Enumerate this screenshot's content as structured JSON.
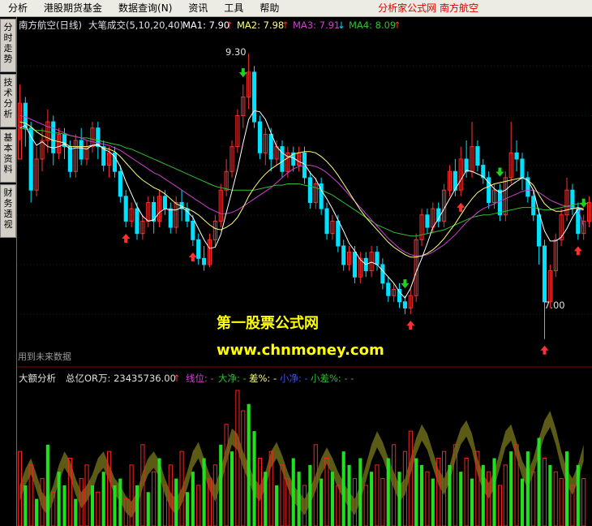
{
  "menubar": {
    "items": [
      "分析",
      "港股期货基金",
      "数据查询(N)",
      "资讯",
      "工具",
      "帮助"
    ],
    "right_text": "分析家公式网  南方航空"
  },
  "sidebar": {
    "tabs": [
      "分时走势",
      "技术分析",
      "基本资料",
      "财务透视"
    ]
  },
  "main_header": {
    "title": "南方航空(日线)",
    "indicator": "大笔成交(5,10,20,40)",
    "ma1": "MA1: 7.90",
    "ma1_arrow": "↑",
    "ma2": "MA2: 7.98",
    "ma2_arrow": "↑",
    "ma3": "MA3: 7.91",
    "ma3_arrow": "↓",
    "ma4": "MA4: 8.09",
    "ma4_arrow": "↑"
  },
  "annotations": {
    "high_label": "9.30",
    "low_label": "7.00",
    "future_data_note": "用到未来数据"
  },
  "watermark": {
    "line1": "第一股票公式网",
    "line2": "www.chnmoney.com"
  },
  "lower_header": {
    "title": "大额分析",
    "total_label": "总亿OR万: 23435736.00",
    "total_arrow": "↑",
    "line_pos": "线位: -",
    "big_net": "大净: -",
    "diff": "差%: -",
    "small_net": "小净: -",
    "small_diff": "小差%: - -"
  },
  "colors": {
    "up": "#ff3030",
    "down": "#00e0ff",
    "ma1": "#ffffff",
    "ma2": "#ffff80",
    "ma3": "#d040d0",
    "ma4": "#30c030",
    "menu_bg": "#ecebe4",
    "signal_up": "#ff3030",
    "signal_down": "#20d020"
  },
  "chart_data": {
    "type": "candlestick",
    "title": "南方航空(日线)",
    "ylim": [
      6.9,
      9.45
    ],
    "candles": [
      [
        8.45,
        8.9,
        8.6,
        9.05
      ],
      [
        8.9,
        8.7,
        8.55,
        8.95
      ],
      [
        8.7,
        8.2,
        8.1,
        8.75
      ],
      [
        8.2,
        8.45,
        8.15,
        8.55
      ],
      [
        8.45,
        8.6,
        8.35,
        8.7
      ],
      [
        8.6,
        8.75,
        8.5,
        8.85
      ],
      [
        8.75,
        8.5,
        8.4,
        8.8
      ],
      [
        8.5,
        8.65,
        8.45,
        8.7
      ],
      [
        8.65,
        8.55,
        8.45,
        8.7
      ],
      [
        8.55,
        8.35,
        8.3,
        8.6
      ],
      [
        8.35,
        8.6,
        8.3,
        8.65
      ],
      [
        8.6,
        8.45,
        8.4,
        8.7
      ],
      [
        8.45,
        8.55,
        8.4,
        8.6
      ],
      [
        8.55,
        8.7,
        8.5,
        8.75
      ],
      [
        8.7,
        8.55,
        8.45,
        8.75
      ],
      [
        8.55,
        8.4,
        8.35,
        8.6
      ],
      [
        8.4,
        8.5,
        8.3,
        8.55
      ],
      [
        8.5,
        8.35,
        8.3,
        8.55
      ],
      [
        8.35,
        8.15,
        8.1,
        8.4
      ],
      [
        8.15,
        7.95,
        7.9,
        8.2
      ],
      [
        7.95,
        8.05,
        7.9,
        8.1
      ],
      [
        8.05,
        7.85,
        7.8,
        8.1
      ],
      [
        7.85,
        7.95,
        7.8,
        8.0
      ],
      [
        7.95,
        8.1,
        7.9,
        8.15
      ],
      [
        8.1,
        7.95,
        7.85,
        8.15
      ],
      [
        7.95,
        8.15,
        7.9,
        8.2
      ],
      [
        8.15,
        8.05,
        8.0,
        8.2
      ],
      [
        8.05,
        7.9,
        7.85,
        8.1
      ],
      [
        7.9,
        8.1,
        7.85,
        8.15
      ],
      [
        8.1,
        8.05,
        7.95,
        8.2
      ],
      [
        8.05,
        7.95,
        7.9,
        8.1
      ],
      [
        7.95,
        7.8,
        7.75,
        8.0
      ],
      [
        7.8,
        7.65,
        7.6,
        7.85
      ],
      [
        7.65,
        7.6,
        7.55,
        7.75
      ],
      [
        7.6,
        7.8,
        7.58,
        7.85
      ],
      [
        7.8,
        7.95,
        7.75,
        8.0
      ],
      [
        7.95,
        8.2,
        7.9,
        8.25
      ],
      [
        8.2,
        8.35,
        8.15,
        8.45
      ],
      [
        8.35,
        8.55,
        8.3,
        8.6
      ],
      [
        8.55,
        8.8,
        8.5,
        8.85
      ],
      [
        8.8,
        8.95,
        8.7,
        9.05
      ],
      [
        8.95,
        9.15,
        8.85,
        9.3
      ],
      [
        9.15,
        8.75,
        8.7,
        9.2
      ],
      [
        8.75,
        8.5,
        8.45,
        8.8
      ],
      [
        8.5,
        8.65,
        8.4,
        8.7
      ],
      [
        8.65,
        8.45,
        8.35,
        8.7
      ],
      [
        8.45,
        8.55,
        8.4,
        8.6
      ],
      [
        8.55,
        8.35,
        8.3,
        8.6
      ],
      [
        8.35,
        8.5,
        8.3,
        8.55
      ],
      [
        8.5,
        8.4,
        8.35,
        8.55
      ],
      [
        8.4,
        8.5,
        8.35,
        8.55
      ],
      [
        8.5,
        8.3,
        8.25,
        8.55
      ],
      [
        8.3,
        8.1,
        8.05,
        8.35
      ],
      [
        8.1,
        8.25,
        8.05,
        8.3
      ],
      [
        8.25,
        8.05,
        8.0,
        8.3
      ],
      [
        8.05,
        7.85,
        7.8,
        8.1
      ],
      [
        7.85,
        7.95,
        7.8,
        8.0
      ],
      [
        7.95,
        7.75,
        7.7,
        8.0
      ],
      [
        7.75,
        7.6,
        7.55,
        7.8
      ],
      [
        7.6,
        7.7,
        7.55,
        7.75
      ],
      [
        7.7,
        7.5,
        7.45,
        7.75
      ],
      [
        7.5,
        7.65,
        7.45,
        7.7
      ],
      [
        7.65,
        7.55,
        7.5,
        7.7
      ],
      [
        7.55,
        7.7,
        7.5,
        7.75
      ],
      [
        7.7,
        7.6,
        7.55,
        7.75
      ],
      [
        7.6,
        7.45,
        7.4,
        7.65
      ],
      [
        7.45,
        7.35,
        7.3,
        7.5
      ],
      [
        7.35,
        7.4,
        7.3,
        7.45
      ],
      [
        7.4,
        7.3,
        7.25,
        7.45
      ],
      [
        7.3,
        7.25,
        7.2,
        7.35
      ],
      [
        7.25,
        7.35,
        7.2,
        7.4
      ],
      [
        7.35,
        7.8,
        7.3,
        7.85
      ],
      [
        7.8,
        8.0,
        7.75,
        8.05
      ],
      [
        8.0,
        7.9,
        7.85,
        8.05
      ],
      [
        7.9,
        8.05,
        7.85,
        8.1
      ],
      [
        8.05,
        7.95,
        7.9,
        8.1
      ],
      [
        7.95,
        8.2,
        7.9,
        8.25
      ],
      [
        8.2,
        8.35,
        8.15,
        8.4
      ],
      [
        8.35,
        8.2,
        8.15,
        8.45
      ],
      [
        8.2,
        8.45,
        8.15,
        8.55
      ],
      [
        8.45,
        8.35,
        8.3,
        8.6
      ],
      [
        8.35,
        8.55,
        8.3,
        8.75
      ],
      [
        8.55,
        8.4,
        8.35,
        8.6
      ],
      [
        8.4,
        8.3,
        8.25,
        8.45
      ],
      [
        8.3,
        8.1,
        8.05,
        8.35
      ],
      [
        8.1,
        8.2,
        8.05,
        8.25
      ],
      [
        8.2,
        8.0,
        7.95,
        8.25
      ],
      [
        8.0,
        8.3,
        7.95,
        8.35
      ],
      [
        8.3,
        8.5,
        8.25,
        8.75
      ],
      [
        8.5,
        8.45,
        8.35,
        8.6
      ],
      [
        8.45,
        8.3,
        8.2,
        8.5
      ],
      [
        8.3,
        8.15,
        8.1,
        8.35
      ],
      [
        8.15,
        8.0,
        7.95,
        8.2
      ],
      [
        8.0,
        7.75,
        7.6,
        8.05
      ],
      [
        7.75,
        7.3,
        7.0,
        7.8
      ],
      [
        7.3,
        7.55,
        7.25,
        7.6
      ],
      [
        7.55,
        7.8,
        7.5,
        7.85
      ],
      [
        7.8,
        8.0,
        7.75,
        8.05
      ],
      [
        8.0,
        8.2,
        7.95,
        8.3
      ],
      [
        8.2,
        8.05,
        8.0,
        8.25
      ],
      [
        8.05,
        7.85,
        7.8,
        8.1
      ],
      [
        7.85,
        7.95,
        7.8,
        8.0
      ],
      [
        7.95,
        8.1,
        7.9,
        8.15
      ]
    ],
    "ma1": [
      8.7,
      8.72,
      8.63,
      8.56,
      8.59,
      8.55,
      8.54,
      8.55,
      8.57,
      8.53,
      8.54,
      8.54,
      8.53,
      8.56,
      8.57,
      8.53,
      8.51,
      8.47,
      8.39,
      8.27,
      8.17,
      8.07,
      7.99,
      7.95,
      7.96,
      8.02,
      8.05,
      8.04,
      8.04,
      8.06,
      8.03,
      7.98,
      7.89,
      7.8,
      7.73,
      7.74,
      7.84,
      8.02,
      8.19,
      8.37,
      8.58,
      8.77,
      8.84,
      8.83,
      8.77,
      8.66,
      8.55,
      8.5,
      8.47,
      8.46,
      8.43,
      8.41,
      8.34,
      8.29,
      8.2,
      8.13,
      8.05,
      7.96,
      7.87,
      7.77,
      7.71,
      7.64,
      7.6,
      7.62,
      7.6,
      7.55,
      7.5,
      7.45,
      7.38,
      7.33,
      7.41,
      7.54,
      7.65,
      7.77,
      7.9,
      7.97,
      8.05,
      8.13,
      8.21,
      8.28,
      8.36,
      8.35,
      8.33,
      8.31,
      8.26,
      8.21,
      8.18,
      8.2,
      8.24,
      8.27,
      8.3,
      8.28,
      8.2,
      8.02,
      7.87,
      7.79,
      7.79,
      7.82,
      7.89,
      7.98,
      8.05,
      8.04
    ],
    "ma2": [
      8.75,
      8.74,
      8.71,
      8.67,
      8.64,
      8.62,
      8.6,
      8.59,
      8.58,
      8.55,
      8.55,
      8.55,
      8.55,
      8.56,
      8.56,
      8.54,
      8.53,
      8.51,
      8.47,
      8.42,
      8.37,
      8.32,
      8.28,
      8.25,
      8.22,
      8.2,
      8.17,
      8.13,
      8.09,
      8.07,
      8.05,
      8.03,
      8.0,
      7.96,
      7.92,
      7.89,
      7.88,
      7.9,
      7.93,
      7.98,
      8.06,
      8.15,
      8.22,
      8.28,
      8.33,
      8.37,
      8.4,
      8.43,
      8.46,
      8.49,
      8.5,
      8.51,
      8.51,
      8.5,
      8.47,
      8.43,
      8.38,
      8.32,
      8.25,
      8.18,
      8.11,
      8.04,
      7.98,
      7.93,
      7.88,
      7.83,
      7.78,
      7.74,
      7.71,
      7.68,
      7.66,
      7.66,
      7.67,
      7.69,
      7.72,
      7.76,
      7.81,
      7.87,
      7.93,
      8.0,
      8.07,
      8.13,
      8.18,
      8.21,
      8.23,
      8.25,
      8.26,
      8.27,
      8.28,
      8.29,
      8.3,
      8.28,
      8.24,
      8.16,
      8.09,
      8.05,
      8.03,
      8.03,
      8.04,
      8.05,
      8.06,
      8.05
    ],
    "ma3": [
      8.8,
      8.79,
      8.77,
      8.75,
      8.73,
      8.71,
      8.7,
      8.68,
      8.66,
      8.64,
      8.63,
      8.62,
      8.6,
      8.59,
      8.58,
      8.57,
      8.56,
      8.54,
      8.52,
      8.49,
      8.46,
      8.43,
      8.4,
      8.37,
      8.34,
      8.32,
      8.29,
      8.26,
      8.23,
      8.2,
      8.17,
      8.14,
      8.11,
      8.08,
      8.05,
      8.03,
      8.01,
      8.01,
      8.02,
      8.04,
      8.07,
      8.1,
      8.13,
      8.16,
      8.19,
      8.22,
      8.26,
      8.3,
      8.34,
      8.37,
      8.39,
      8.4,
      8.4,
      8.39,
      8.37,
      8.34,
      8.3,
      8.26,
      8.21,
      8.16,
      8.11,
      8.06,
      8.01,
      7.96,
      7.91,
      7.86,
      7.81,
      7.77,
      7.73,
      7.7,
      7.68,
      7.67,
      7.67,
      7.68,
      7.7,
      7.73,
      7.76,
      7.8,
      7.84,
      7.89,
      7.94,
      7.98,
      8.02,
      8.05,
      8.07,
      8.09,
      8.11,
      8.13,
      8.15,
      8.17,
      8.19,
      8.2,
      8.2,
      8.18,
      8.15,
      8.12,
      8.1,
      8.08,
      8.07,
      8.06,
      8.05,
      7.91
    ],
    "ma4": [
      8.7,
      8.69,
      8.69,
      8.68,
      8.68,
      8.67,
      8.66,
      8.66,
      8.65,
      8.64,
      8.63,
      8.62,
      8.62,
      8.61,
      8.6,
      8.59,
      8.58,
      8.57,
      8.56,
      8.54,
      8.53,
      8.51,
      8.49,
      8.47,
      8.45,
      8.43,
      8.41,
      8.39,
      8.37,
      8.35,
      8.33,
      8.31,
      8.29,
      8.27,
      8.25,
      8.23,
      8.22,
      8.21,
      8.2,
      8.2,
      8.2,
      8.2,
      8.2,
      8.21,
      8.22,
      8.23,
      8.24,
      8.24,
      8.25,
      8.25,
      8.25,
      8.24,
      8.23,
      8.22,
      8.2,
      8.18,
      8.16,
      8.13,
      8.1,
      8.07,
      8.04,
      8.01,
      7.98,
      7.95,
      7.92,
      7.9,
      7.88,
      7.86,
      7.85,
      7.84,
      7.83,
      7.83,
      7.84,
      7.85,
      7.86,
      7.87,
      7.88,
      7.9,
      7.92,
      7.94,
      7.96,
      7.98,
      7.99,
      8.0,
      8.0,
      8.01,
      8.02,
      8.03,
      8.04,
      8.05,
      8.06,
      8.06,
      8.06,
      8.05,
      8.04,
      8.04,
      8.05,
      8.06,
      8.07,
      8.08,
      8.09,
      8.09
    ],
    "buy_signals": [
      19,
      31,
      70,
      79,
      94,
      100
    ],
    "sell_signals": [
      40,
      69,
      86,
      101
    ],
    "volume": [
      0.55,
      0.3,
      0.45,
      0.2,
      0.35,
      0.6,
      0.25,
      0.4,
      0.3,
      0.5,
      0.2,
      0.35,
      0.45,
      0.3,
      0.25,
      0.4,
      0.55,
      0.3,
      0.35,
      0.2,
      0.45,
      0.3,
      0.6,
      0.25,
      0.4,
      0.5,
      0.3,
      0.45,
      0.35,
      0.55,
      0.25,
      0.4,
      0.3,
      0.5,
      0.35,
      0.45,
      0.6,
      0.75,
      0.55,
      1.0,
      0.85,
      0.9,
      0.7,
      0.5,
      0.4,
      0.55,
      0.3,
      0.45,
      0.35,
      0.5,
      0.4,
      0.3,
      0.45,
      0.6,
      0.35,
      0.5,
      0.4,
      0.3,
      0.55,
      0.45,
      0.35,
      0.5,
      0.3,
      0.4,
      0.45,
      0.35,
      0.5,
      0.6,
      0.4,
      0.55,
      0.7,
      0.5,
      0.45,
      0.4,
      0.35,
      0.5,
      0.55,
      0.45,
      0.6,
      0.4,
      0.5,
      0.35,
      0.55,
      0.45,
      0.4,
      0.5,
      0.3,
      0.45,
      0.55,
      0.6,
      0.35,
      0.55,
      0.4,
      0.65,
      0.5,
      0.45,
      0.4,
      0.35,
      0.55,
      0.3,
      0.45,
      0.35
    ],
    "volume_dir": [
      1,
      0,
      1,
      0,
      1,
      0,
      1,
      0,
      0,
      1,
      0,
      1,
      1,
      0,
      1,
      0,
      1,
      0,
      0,
      1,
      1,
      0,
      1,
      0,
      1,
      0,
      1,
      1,
      0,
      1,
      0,
      0,
      1,
      0,
      1,
      1,
      0,
      1,
      0,
      1,
      1,
      0,
      0,
      1,
      0,
      1,
      0,
      1,
      1,
      0,
      0,
      1,
      0,
      1,
      0,
      1,
      0,
      1,
      0,
      0,
      1,
      0,
      1,
      0,
      1,
      1,
      0,
      1,
      0,
      1,
      1,
      0,
      0,
      1,
      0,
      1,
      1,
      0,
      1,
      0,
      1,
      0,
      1,
      0,
      1,
      0,
      1,
      1,
      0,
      1,
      0,
      0,
      1,
      0,
      1,
      0,
      1,
      1,
      0,
      1,
      0,
      1
    ],
    "band": [
      0.3,
      0.42,
      0.5,
      0.38,
      0.25,
      0.2,
      0.3,
      0.45,
      0.55,
      0.48,
      0.35,
      0.25,
      0.3,
      0.38,
      0.5,
      0.55,
      0.45,
      0.35,
      0.3,
      0.22,
      0.18,
      0.25,
      0.4,
      0.5,
      0.55,
      0.48,
      0.35,
      0.25,
      0.2,
      0.28,
      0.4,
      0.55,
      0.62,
      0.5,
      0.38,
      0.3,
      0.42,
      0.58,
      0.72,
      0.68,
      0.55,
      0.45,
      0.35,
      0.3,
      0.4,
      0.55,
      0.62,
      0.52,
      0.4,
      0.3,
      0.25,
      0.2,
      0.28,
      0.38,
      0.5,
      0.58,
      0.5,
      0.4,
      0.32,
      0.25,
      0.2,
      0.3,
      0.45,
      0.6,
      0.7,
      0.62,
      0.5,
      0.4,
      0.3,
      0.35,
      0.5,
      0.65,
      0.75,
      0.68,
      0.55,
      0.42,
      0.35,
      0.45,
      0.6,
      0.72,
      0.78,
      0.68,
      0.5,
      0.38,
      0.32,
      0.4,
      0.55,
      0.7,
      0.75,
      0.62,
      0.48,
      0.4,
      0.5,
      0.65,
      0.78,
      0.85,
      0.72,
      0.55,
      0.42,
      0.35,
      0.45,
      0.6
    ]
  }
}
